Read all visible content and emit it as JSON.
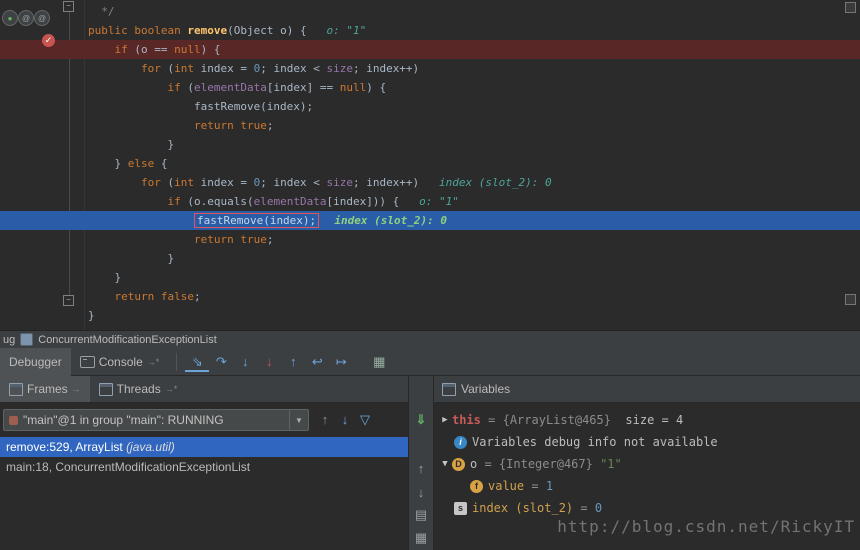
{
  "colors": {
    "editor_bg": "#2b2b2b",
    "panel_bg": "#3c3f41",
    "exec_line": "#2a5da8",
    "breakpoint_line": "#5a2727",
    "selection": "#3065c0",
    "breakpoint_icon": "#c75450"
  },
  "icons": {
    "check": "✓",
    "at": "@",
    "run_dot": "●",
    "fold": "−",
    "collapsed": "▶",
    "expanded": "▼",
    "combo_arrow": "▼"
  },
  "editor": {
    "breakpoint_line": 2,
    "exec_line": 11,
    "lines": [
      [
        [
          "comment",
          "  */"
        ]
      ],
      [
        [
          "kw",
          "public"
        ],
        [
          "plain",
          " "
        ],
        [
          "kw",
          "boolean"
        ],
        [
          "plain",
          " "
        ],
        [
          "method",
          "remove"
        ],
        [
          "plain",
          "(Object o) {"
        ],
        [
          "hint",
          "   o: \"1\""
        ]
      ],
      [
        [
          "plain",
          "    "
        ],
        [
          "kw",
          "if"
        ],
        [
          "plain",
          " (o == "
        ],
        [
          "kw",
          "null"
        ],
        [
          "plain",
          ") {"
        ]
      ],
      [
        [
          "plain",
          "        "
        ],
        [
          "kw",
          "for"
        ],
        [
          "plain",
          " ("
        ],
        [
          "kw",
          "int"
        ],
        [
          "plain",
          " index = "
        ],
        [
          "num",
          "0"
        ],
        [
          "plain",
          "; index < "
        ],
        [
          "field",
          "size"
        ],
        [
          "plain",
          "; index++)"
        ]
      ],
      [
        [
          "plain",
          "            "
        ],
        [
          "kw",
          "if"
        ],
        [
          "plain",
          " ("
        ],
        [
          "field",
          "elementData"
        ],
        [
          "plain",
          "[index] == "
        ],
        [
          "kw",
          "null"
        ],
        [
          "plain",
          ") {"
        ]
      ],
      [
        [
          "plain",
          "                fastRemove(index);"
        ]
      ],
      [
        [
          "plain",
          "                "
        ],
        [
          "kw",
          "return"
        ],
        [
          "plain",
          " "
        ],
        [
          "kw",
          "true"
        ],
        [
          "plain",
          ";"
        ]
      ],
      [
        [
          "plain",
          "            }"
        ]
      ],
      [
        [
          "plain",
          "    } "
        ],
        [
          "kw",
          "else"
        ],
        [
          "plain",
          " {"
        ]
      ],
      [
        [
          "plain",
          "        "
        ],
        [
          "kw",
          "for"
        ],
        [
          "plain",
          " ("
        ],
        [
          "kw",
          "int"
        ],
        [
          "plain",
          " index = "
        ],
        [
          "num",
          "0"
        ],
        [
          "plain",
          "; index < "
        ],
        [
          "field",
          "size"
        ],
        [
          "plain",
          "; index++)"
        ],
        [
          "hint",
          "   index (slot_2): 0"
        ]
      ],
      [
        [
          "plain",
          "            "
        ],
        [
          "kw",
          "if"
        ],
        [
          "plain",
          " (o.equals("
        ],
        [
          "field",
          "elementData"
        ],
        [
          "plain",
          "[index])) {"
        ],
        [
          "hint",
          "   o: \"1\""
        ]
      ],
      [
        [
          "plain",
          "                "
        ],
        [
          "boxed",
          "fastRemove(index);"
        ],
        [
          "hint2",
          "  index (slot_2): 0"
        ]
      ],
      [
        [
          "plain",
          "                "
        ],
        [
          "kw",
          "return"
        ],
        [
          "plain",
          " "
        ],
        [
          "kw",
          "true"
        ],
        [
          "plain",
          ";"
        ]
      ],
      [
        [
          "plain",
          "            }"
        ]
      ],
      [
        [
          "plain",
          "    }"
        ]
      ],
      [
        [
          "plain",
          "    "
        ],
        [
          "kw",
          "return"
        ],
        [
          "plain",
          " "
        ],
        [
          "kw",
          "false"
        ],
        [
          "plain",
          ";"
        ]
      ],
      [
        [
          "plain",
          "}"
        ]
      ]
    ],
    "gutter_icons": [
      [
        "run-overlay-icon",
        "●",
        "#64b85c"
      ],
      [
        "annotation-icon",
        "@",
        "#9aa0a6"
      ],
      [
        "annotation-icon",
        "@",
        "#9aa0a6"
      ]
    ]
  },
  "debug": {
    "titlebar": {
      "prefix": "ug",
      "title": "ConcurrentModificationExceptionList"
    },
    "tabs": {
      "debugger": "Debugger",
      "console": "Console",
      "console_suffix": "→*"
    },
    "toolbar_icons": [
      {
        "name": "show-execution-point-icon",
        "glyph": "⇘",
        "cls": "blue"
      },
      {
        "name": "step-over-icon",
        "glyph": "↷",
        "cls": "blue"
      },
      {
        "name": "step-into-icon",
        "glyph": "↓",
        "cls": "blue"
      },
      {
        "name": "force-step-into-icon",
        "glyph": "↓",
        "cls": "red"
      },
      {
        "name": "step-out-icon",
        "glyph": "↑",
        "cls": "blue"
      },
      {
        "name": "drop-frame-icon",
        "glyph": "↩",
        "cls": "blue"
      },
      {
        "name": "run-to-cursor-icon",
        "glyph": "↦",
        "cls": "blue"
      }
    ],
    "restore_layout_glyph": "▦",
    "frames": {
      "tab_frames": "Frames",
      "tab_frames_suffix": "→",
      "tab_threads": "Threads",
      "tab_threads_suffix": "→*",
      "thread_combo": "\"main\"@1 in group \"main\": RUNNING",
      "nav_icons": [
        [
          "prev-frame-icon",
          "↑",
          "gray"
        ],
        [
          "next-frame-icon",
          "↓",
          "blue"
        ],
        [
          "filter-frames-icon",
          "▽",
          "blue"
        ]
      ],
      "rows": [
        {
          "selected": true,
          "tokens": [
            [
              "fplain",
              "remove:529, ArrayList "
            ],
            [
              "fitalic",
              "(java.util)"
            ]
          ]
        },
        {
          "selected": false,
          "tokens": [
            [
              "fplain",
              "main:18, ConcurrentModificationExceptionList"
            ]
          ]
        }
      ]
    },
    "side_icons": [
      [
        "green-down-arrow-icon",
        "⇓",
        "green gap"
      ],
      [
        "up-arrow-icon",
        "↑",
        "gray"
      ],
      [
        "down-arrow-icon",
        "↓",
        "gray"
      ],
      [
        "copy-stack-icon",
        "▤",
        "gray"
      ],
      [
        "settings-icon",
        "▦",
        "gray"
      ]
    ],
    "variables": {
      "header": "Variables",
      "rows": [
        {
          "expander": "collapsed",
          "icon": null,
          "indent": 0,
          "tokens": [
            [
              "vthis",
              "this"
            ],
            [
              "vgray",
              " = "
            ],
            [
              "vref",
              "{ArrayList@465} "
            ],
            [
              "vplain",
              " size = 4"
            ]
          ]
        },
        {
          "expander": null,
          "icon": [
            "info-icon",
            "i",
            "circ-blue"
          ],
          "indent": 1,
          "tokens": [
            [
              "vplain",
              "Variables debug info not available"
            ]
          ]
        },
        {
          "expander": "expanded",
          "icon": [
            "parameter-icon",
            "D",
            "circ-orange"
          ],
          "indent": 0,
          "tokens": [
            [
              "vplain",
              "o"
            ],
            [
              "vgray",
              " = "
            ],
            [
              "vref",
              "{Integer@467} "
            ],
            [
              "vstr",
              "\"1\""
            ]
          ]
        },
        {
          "expander": null,
          "icon": [
            "field-icon",
            "f",
            "circ-orange"
          ],
          "indent": 2,
          "tokens": [
            [
              "vorange",
              "value"
            ],
            [
              "vgray",
              " = "
            ],
            [
              "vnum",
              "1"
            ]
          ]
        },
        {
          "expander": null,
          "icon": [
            "slot-icon",
            "s",
            "sq-gray"
          ],
          "indent": 1,
          "tokens": [
            [
              "vorange",
              "index (slot_2)"
            ],
            [
              "vgray",
              " = "
            ],
            [
              "vnum",
              "0"
            ]
          ]
        }
      ]
    }
  },
  "watermark": "http://blog.csdn.net/RickyIT"
}
